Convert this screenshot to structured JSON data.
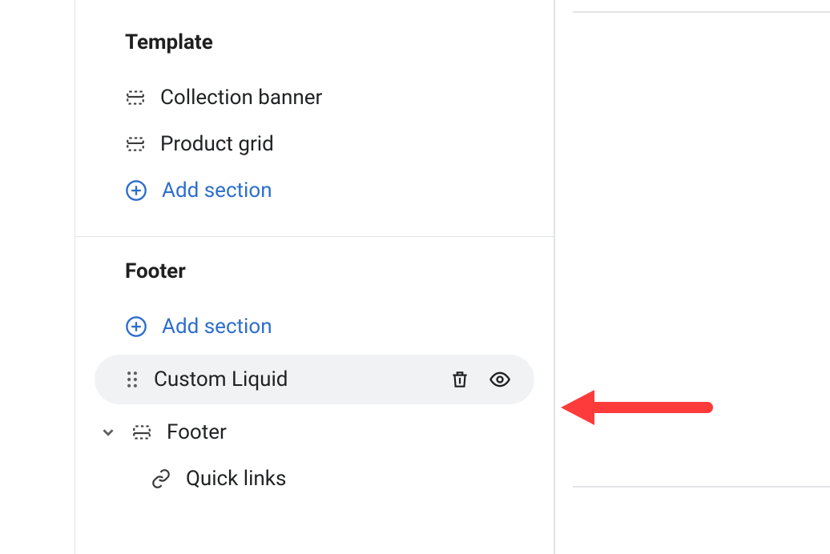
{
  "template": {
    "heading": "Template",
    "items": [
      {
        "label": "Collection banner"
      },
      {
        "label": "Product grid"
      }
    ],
    "add_label": "Add section"
  },
  "footer": {
    "heading": "Footer",
    "add_label": "Add section",
    "custom_liquid": {
      "label": "Custom Liquid"
    },
    "footer_section": {
      "label": "Footer",
      "children": [
        {
          "label": "Quick links"
        }
      ]
    }
  },
  "colors": {
    "link": "#2c6ecb",
    "text": "#202223",
    "hover_bg": "#f1f2f3",
    "arrow": "#fd3b3b"
  }
}
